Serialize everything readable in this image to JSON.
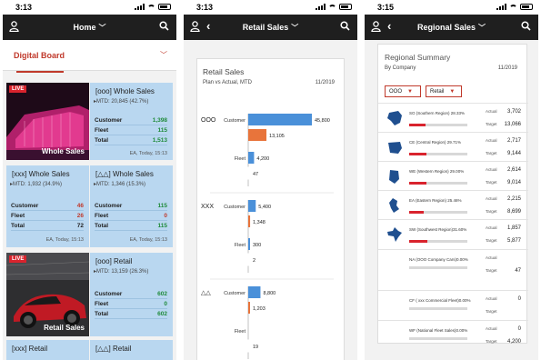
{
  "colors": {
    "accent": "#c0392b",
    "nav": "#1f1f1f",
    "tile": "#b9d7f0",
    "bar_blue": "#4a90d9",
    "bar_orange": "#e8743b"
  },
  "screens": [
    {
      "status_time": "3:13",
      "nav_title": "Home",
      "board_title": "Digital Board",
      "tiles": [
        {
          "live": "LIVE",
          "caption": "Whole Sales"
        },
        {
          "name": "[ooo] Whole Sales",
          "mtd": "MTD: 20,845 (42.7%)",
          "rows": [
            {
              "label": "Customer",
              "value": "1,398"
            },
            {
              "label": "Fleet",
              "value": "115"
            },
            {
              "label": "Total",
              "value": "1,513"
            }
          ],
          "foot": "EA, Today, 15:13"
        },
        {
          "name": "[xxx] Whole Sales",
          "mtd": "MTD: 1,932 (34.9%)",
          "rows": [
            {
              "label": "Customer",
              "value": "46"
            },
            {
              "label": "Fleet",
              "value": "26"
            },
            {
              "label": "Total",
              "value": "72"
            }
          ],
          "foot": "EA, Today, 15:13"
        },
        {
          "name": "[△△] Whole Sales",
          "mtd": "MTD: 1,346 (15.3%)",
          "rows": [
            {
              "label": "Customer",
              "value": "115"
            },
            {
              "label": "Fleet",
              "value": "0"
            },
            {
              "label": "Total",
              "value": "115"
            }
          ],
          "foot": "EA, Today, 15:13"
        },
        {
          "live": "LIVE",
          "caption": "Retail Sales"
        },
        {
          "name": "[ooo] Retail",
          "mtd": "MTD: 13,159 (26.3%)",
          "rows": [
            {
              "label": "Customer",
              "value": "602"
            },
            {
              "label": "Fleet",
              "value": "0"
            },
            {
              "label": "Total",
              "value": "602"
            }
          ],
          "foot": ""
        },
        {
          "name": "[xxx] Retail",
          "mtd": "",
          "rows": [],
          "foot": ""
        },
        {
          "name": "[△△] Retail",
          "mtd": "",
          "rows": [],
          "foot": ""
        }
      ]
    },
    {
      "status_time": "3:13",
      "nav_title": "Retail Sales",
      "card_title": "Retail Sales",
      "card_subtitle": "Plan vs Actual, MTD",
      "card_date": "11/2019"
    },
    {
      "status_time": "3:15",
      "nav_title": "Regional Sales",
      "card_title": "Regional Summary",
      "card_subtitle": "By Company",
      "card_date": "11/2019",
      "filters": [
        "OOO",
        "Retail"
      ],
      "actual_label": "Actual",
      "target_label": "Target",
      "regions": [
        {
          "name": "SO (Southern Region) 28.33%",
          "actual": "3,702",
          "target": "13,066",
          "progress": 0.28,
          "map": "so-region-map"
        },
        {
          "name": "CE (Central Region)  29.71%",
          "actual": "2,717",
          "target": "9,144",
          "progress": 0.3,
          "map": "ce-region-map"
        },
        {
          "name": "WE (Western Region) 29.00%",
          "actual": "2,614",
          "target": "9,014",
          "progress": 0.29,
          "map": "we-region-map"
        },
        {
          "name": "EA (Eastern Region)  25.46%",
          "actual": "2,215",
          "target": "8,699",
          "progress": 0.25,
          "map": "ea-region-map"
        },
        {
          "name": "SW (Southwest Region)31.60%",
          "actual": "1,857",
          "target": "5,877",
          "progress": 0.32,
          "map": "sw-region-map"
        },
        {
          "name": "NA (OOO Company Cars)0.00%",
          "actual": "",
          "target": "47",
          "progress": 0,
          "map": ""
        },
        {
          "name": "CF ( xxx Commercial Fleet)0.00%",
          "actual": "0",
          "target": "",
          "progress": 0,
          "map": ""
        },
        {
          "name": "WF (National Fleet Sales)0.00%",
          "actual": "0",
          "target": "4,200",
          "progress": 0,
          "map": ""
        }
      ]
    }
  ],
  "chart_data": {
    "type": "bar",
    "orientation": "horizontal",
    "groups": [
      {
        "name": "OOO",
        "rows": [
          {
            "label": "Customer",
            "plan": 45800,
            "actual": 13105
          },
          {
            "label": "Fleet",
            "plan": 4200,
            "actual": 47
          }
        ]
      },
      {
        "name": "XXX",
        "rows": [
          {
            "label": "Customer",
            "plan": 5400,
            "actual": 1348
          },
          {
            "label": "Fleet",
            "plan": 300,
            "actual": 2
          }
        ]
      },
      {
        "name": "△△",
        "rows": [
          {
            "label": "Customer",
            "plan": 8800,
            "actual": 1203
          },
          {
            "label": "Fleet",
            "plan": 0,
            "actual": 19
          }
        ]
      }
    ],
    "value_labels": {
      "OOO": [
        "45,800",
        "13,105",
        "4,200",
        "47"
      ],
      "XXX": [
        "5,400",
        "1,348",
        "300",
        "2"
      ],
      "△△": [
        "8,800",
        "1,203",
        "",
        "19"
      ]
    },
    "series": [
      {
        "name": "Plan",
        "color": "#4a90d9"
      },
      {
        "name": "Actual",
        "color": "#e8743b"
      }
    ]
  }
}
